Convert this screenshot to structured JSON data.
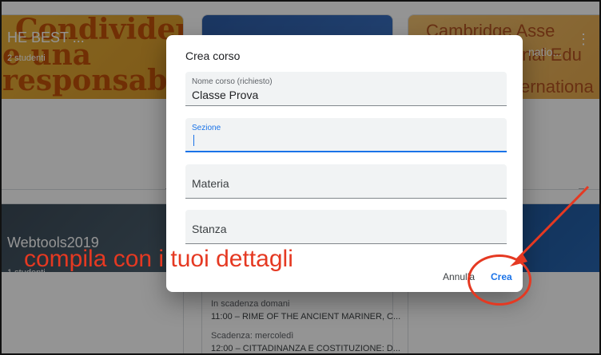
{
  "background": {
    "cards_top": [
      {
        "banner_title": "HE BEST ...",
        "banner_sub": "2 studenti",
        "banner_words": [
          "Condividere",
          "e una",
          "responsab"
        ]
      },
      {
        "banner_title": "",
        "banner_sub": ""
      },
      {
        "banner_title": "Cambridge Asse",
        "banner_sub": "natio...",
        "banner_words": [
          "onal Edu",
          "ernationa"
        ]
      }
    ],
    "cards_bottom": [
      {
        "title": "Webtools2019",
        "sub": "1 studenti"
      }
    ],
    "due": [
      {
        "label": "In scadenza domani",
        "item": "11:00 – RIME OF THE ANCIENT MARINER, C..."
      },
      {
        "label": "Scadenza: mercoledì",
        "item": "12:00 – CITTADINANZA E COSTITUZIONE: D..."
      }
    ],
    "icons": {
      "trend": "trending-up-icon",
      "folder": "folder-icon",
      "more": "more-vert-icon"
    }
  },
  "dialog": {
    "title": "Crea corso",
    "fields": [
      {
        "label": "Nome corso (richiesto)",
        "value": "Classe Prova"
      },
      {
        "label": "Sezione",
        "value": ""
      },
      {
        "placeholder": "Materia"
      },
      {
        "placeholder": "Stanza"
      }
    ],
    "cancel_label": "Annulla",
    "create_label": "Crea"
  },
  "annotation": {
    "text": "compila con i tuoi dettagli",
    "color": "#e53922"
  },
  "colors": {
    "accent": "#1a73e8",
    "annotation": "#e53922"
  }
}
